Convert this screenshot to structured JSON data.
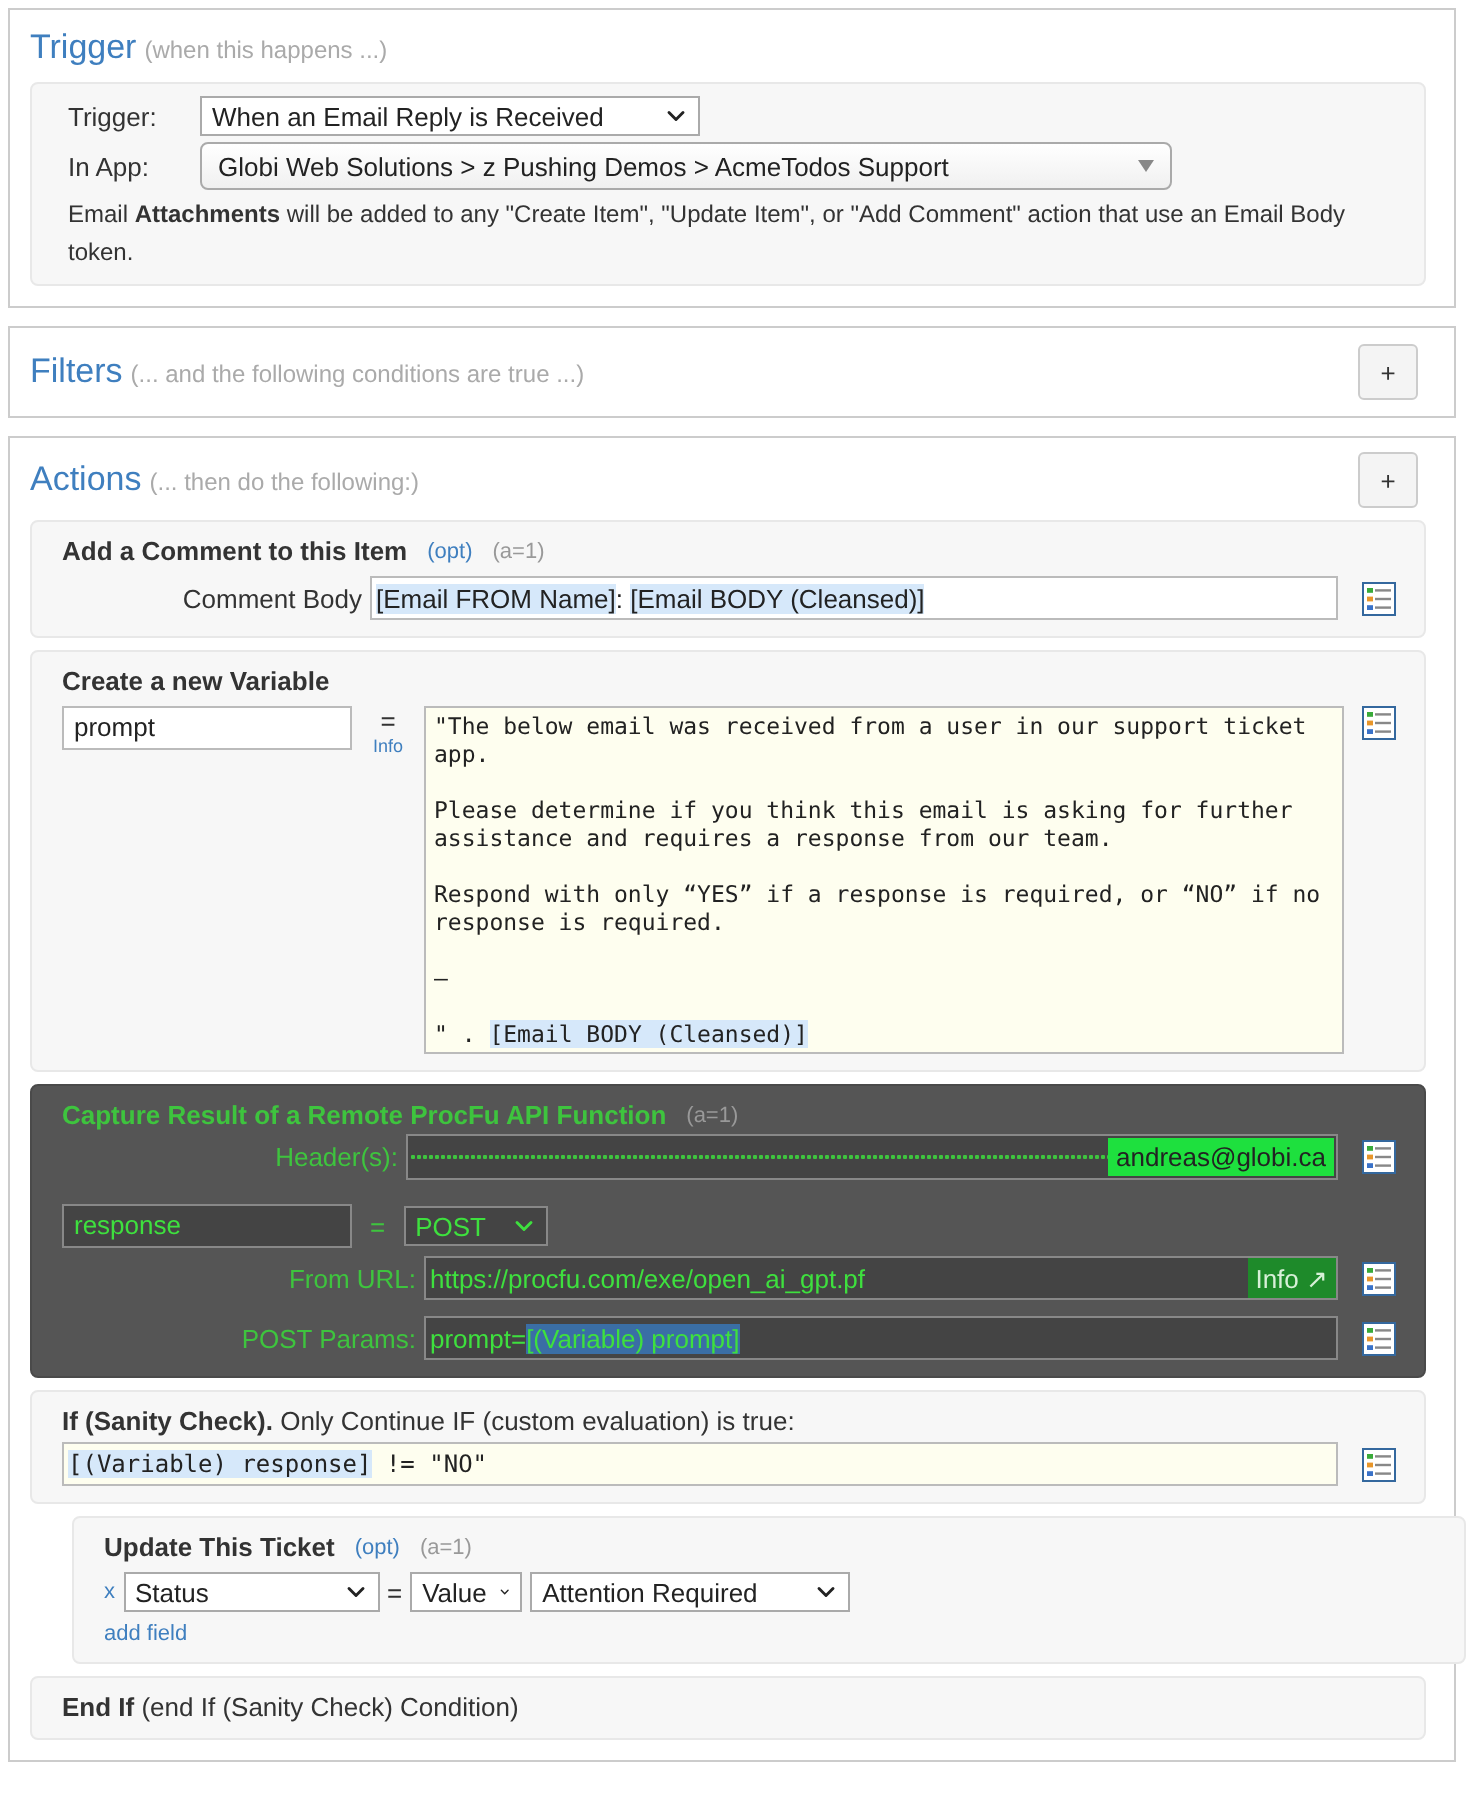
{
  "trigger": {
    "title": "Trigger",
    "subtitle": "(when this happens ...)",
    "trigger_label": "Trigger:",
    "trigger_value": "When an Email Reply is Received",
    "app_label": "In App:",
    "app_value": "Globi Web Solutions > z Pushing Demos > AcmeTodos Support",
    "note": "Email **Attachments** will be added to any \"Create Item\", \"Update Item\", or \"Add Comment\" action that use an Email Body token."
  },
  "filters": {
    "title": "Filters",
    "subtitle": "(... and the following conditions are true ...)",
    "add_button": "+"
  },
  "actions": {
    "title": "Actions",
    "subtitle": "(... then do the following:)",
    "add_button": "+",
    "items": [
      {
        "kind": "comment",
        "title": "Add a Comment to this Item",
        "opt": "(opt)",
        "count": "(a=1)",
        "field_label": "Comment Body",
        "parts": [
          {
            "text": "[Email FROM Name]",
            "token": true
          },
          {
            "text": ": ",
            "token": false
          },
          {
            "text": "[Email BODY (Cleansed)]",
            "token": true
          }
        ]
      },
      {
        "kind": "variable",
        "title": "Create a new Variable",
        "name": "prompt",
        "equals": "=",
        "info": "Info",
        "parts": [
          {
            "text": "\"The below email was received from a user in our support ticket app.\n\nPlease determine if you think this email is asking for further assistance and requires a response from our team.\n\nRespond with only “YES” if a response is required, or “NO” if no response is required.\n\n—\n\n\" . ",
            "token": false
          },
          {
            "text": "[Email BODY (Cleansed)]",
            "token": true
          }
        ]
      },
      {
        "kind": "procfu",
        "title": "Capture Result of a Remote ProcFu API Function",
        "count": "(a=1)",
        "header_label": "Header(s):",
        "header_account": "andreas@globi.ca",
        "name": "response",
        "equals": "=",
        "method": "POST",
        "url_label": "From URL:",
        "url": "https://procfu.com/exe/open_ai_gpt.pf",
        "info": "Info ↗",
        "params_label": "POST Params:",
        "parts": [
          {
            "text": "prompt=",
            "token": false
          },
          {
            "text": "[(Variable) prompt]",
            "token": true
          }
        ]
      },
      {
        "kind": "if",
        "title": "**If (Sanity Check).** Only Continue IF (custom evaluation) is true:",
        "parts": [
          {
            "text": "[(Variable) response]",
            "token": true
          },
          {
            "text": " != \"NO\"",
            "token": false
          }
        ]
      },
      {
        "kind": "update",
        "title": "Update This Ticket",
        "opt": "(opt)",
        "count": "(a=1)",
        "fields": [
          {
            "remove": "x",
            "field": "Status",
            "equals": "=",
            "mode": "Value",
            "value": "Attention Required"
          }
        ],
        "add_link": "add field"
      },
      {
        "kind": "endif",
        "title": "**End If** (end If (Sanity Check) Condition)"
      }
    ]
  }
}
